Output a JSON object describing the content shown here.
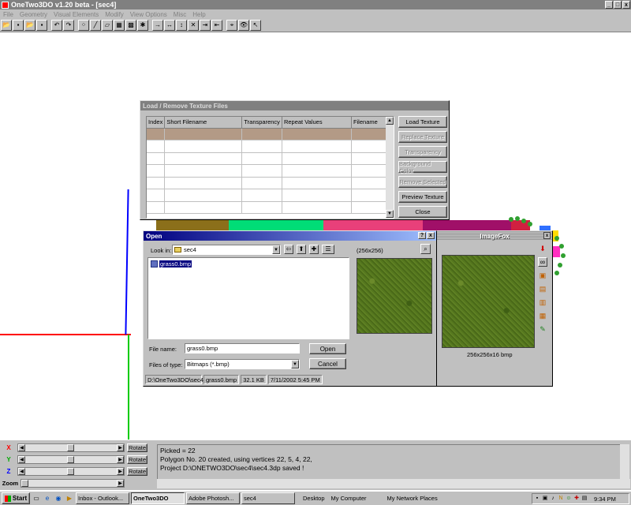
{
  "app": {
    "title": "OneTwo3DO v1.20 beta - [sec4]",
    "window_buttons": [
      "_",
      "□",
      "x"
    ]
  },
  "menu": [
    "File",
    "Geometry",
    "Visual Elements",
    "Modify",
    "View Options",
    "Misc",
    "Help"
  ],
  "axis_colors": {
    "red": "#ff0000",
    "blue": "#0000ff",
    "green": "#00cc00"
  },
  "texture_dialog": {
    "title": "Load / Remove Texture Files",
    "columns": [
      "Index",
      "Short Filename",
      "Transparency",
      "Repeat Values",
      "Filename"
    ],
    "buttons": [
      {
        "label": "Load Texture",
        "enabled": true
      },
      {
        "label": "Replace Texture",
        "enabled": false
      },
      {
        "label": "Transparency",
        "enabled": false
      },
      {
        "label": "Background Color",
        "enabled": false
      },
      {
        "label": "Remove Selected",
        "enabled": false
      },
      {
        "label": "Preview Texture",
        "enabled": true
      },
      {
        "label": "Close",
        "enabled": true
      }
    ]
  },
  "color_strip": [
    "#8b6f1a",
    "#00dd77",
    "#e8407a",
    "#a01068",
    "#d02040"
  ],
  "open_dialog": {
    "title": "Open",
    "look_in_label": "Look in:",
    "look_in_value": "sec4",
    "preview_size": "(256x256)",
    "files": [
      "grass0.bmp"
    ],
    "file_name_label": "File name:",
    "file_name_value": "grass0.bmp",
    "file_type_label": "Files of type:",
    "file_type_value": "Bitmaps (*.bmp)",
    "open_label": "Open",
    "cancel_label": "Cancel",
    "status": [
      "D:\\OneTwo3DO\\sec4",
      "grass0.bmp",
      "32.1 KB",
      "7/11/2002 5:45 PM"
    ]
  },
  "imagefox": {
    "title": "ImageFox",
    "caption": "256x256x16 bmp"
  },
  "bottom": {
    "rows": [
      {
        "axis": "X",
        "color": "#ff0000",
        "button": "Rotate",
        "thumb_fraction": 0.5
      },
      {
        "axis": "Y",
        "color": "#00aa00",
        "button": "Rotate",
        "thumb_fraction": 0.5
      },
      {
        "axis": "Z",
        "color": "#0000ff",
        "button": "Rotate",
        "thumb_fraction": 0.5
      },
      {
        "axis": "Zoom",
        "color": "#000000",
        "button": "",
        "thumb_fraction": 0.0
      }
    ],
    "log": [
      "Picked = 22",
      "Polygon No. 20 created, using vertices 22, 5, 4, 22,",
      "Project D:\\ONETWO3DO\\sec4\\sec4.3dp saved !"
    ]
  },
  "taskbar": {
    "start": "Start",
    "tasks": [
      "Inbox - Outlook...",
      "OneTwo3DO",
      "Adobe Photosh...",
      "sec4"
    ],
    "active_task": "OneTwo3DO",
    "links": [
      "Desktop",
      "My Computer",
      "My Network Places"
    ],
    "clock": "9:34 PM"
  }
}
